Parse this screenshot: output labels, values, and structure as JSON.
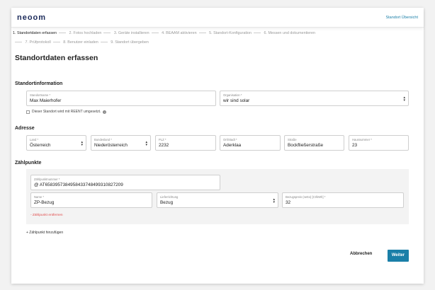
{
  "header": {
    "logo": "neoom",
    "link": "Standort Übersicht"
  },
  "steps": [
    "1. Standortdaten erfassen",
    "2. Fotos hochladen",
    "3. Geräte installieren",
    "4. BEAAM aktivieren",
    "5. Standort-Konfiguration",
    "6. Messen und dokumentieren",
    "7. Prüfprotokoll",
    "8. Benutzer einladen",
    "9. Standort übergeben"
  ],
  "page_title": "Standortdaten erfassen",
  "standortinfo": {
    "heading": "Standortinformation",
    "standortname": {
      "label": "Standortname *",
      "value": "Max Maierhofer"
    },
    "organisation": {
      "label": "Organisation *",
      "value": "wir sind solar"
    },
    "reent_checkbox": "Dieser Standort wird mit REENT umgesetzt."
  },
  "adresse": {
    "heading": "Adresse",
    "land": {
      "label": "Land *",
      "value": "Österreich"
    },
    "bundesland": {
      "label": "Bundesland *",
      "value": "Niederösterreich"
    },
    "plz": {
      "label": "PLZ *",
      "value": "2232"
    },
    "ort": {
      "label": "Ort/Stadt *",
      "value": "Aderklaa"
    },
    "strasse": {
      "label": "Straße",
      "value": "Bockfließerstraße"
    },
    "hausnummer": {
      "label": "Hausnummer *",
      "value": "23"
    }
  },
  "zaehlpunkte": {
    "heading": "Zählpunkte",
    "nummer": {
      "label": "Zählpunktnummer *",
      "value": "@ AT6583957384958433748499310827209"
    },
    "name": {
      "label": "Name *",
      "value": "ZP-Bezug"
    },
    "richtung": {
      "label": "Lieferrichtung",
      "value": "Bezug"
    },
    "preis": {
      "label": "Bezugspreis (netto) [Ct/kWh] *",
      "value": "32"
    },
    "remove": "- Zählpunkt entfernen",
    "add": "+ Zählpunkt hinzufügen"
  },
  "actions": {
    "cancel": "Abbrechen",
    "next": "Weiter"
  },
  "colors": {
    "accent": "#1a7fa8",
    "danger": "#e04b4b"
  }
}
